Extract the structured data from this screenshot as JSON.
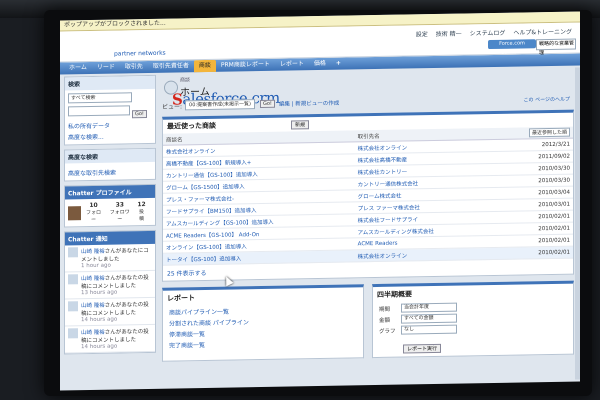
{
  "popup_notice": "ポップアップがブロックされました...",
  "logo": {
    "brand_main": "alesforce",
    "brand_s": "S",
    "brand_crm": " crm",
    "sub": "partner networks"
  },
  "topmeta": [
    "設定",
    "技術 精一",
    "システムログ",
    "ヘルプ&トレーニング"
  ],
  "app_button": "Force.com Sandbox",
  "app_select": "戦略的な営業管理",
  "tabs": [
    {
      "label": "ホーム",
      "active": false
    },
    {
      "label": "リード",
      "active": false
    },
    {
      "label": "取引先",
      "active": false
    },
    {
      "label": "取引先責任者",
      "active": false
    },
    {
      "label": "商談",
      "active": true
    },
    {
      "label": "PRM商談レポート",
      "active": false
    },
    {
      "label": "レポート",
      "active": false
    },
    {
      "label": "価格",
      "active": false
    },
    {
      "label": "+",
      "active": false
    }
  ],
  "sidebar": {
    "search_head": "検索",
    "search_scope": "すべて検索",
    "my_items": "私の所有データ",
    "advanced_link": "高度な検索...",
    "adv_head": "高度な検索",
    "adv_link": "高度な取引先検索",
    "chatter_profile_head": "Chatter プロファイル",
    "stats": [
      {
        "n": "10",
        "l": "フォロー"
      },
      {
        "n": "33",
        "l": "フォロワー"
      },
      {
        "n": "12",
        "l": "投稿"
      }
    ],
    "chatter_notify_head": "Chatter 通知",
    "notifications": [
      {
        "who": "山崎 隆裕",
        "text": "さんがあなたにコメントしました",
        "time": "1 hour ago"
      },
      {
        "who": "山崎 隆裕",
        "text": "さんがあなたの投稿にコメントしました",
        "time": "13 hours ago"
      },
      {
        "who": "山崎 隆裕",
        "text": "さんがあなたの投稿にコメントしました",
        "time": "14 hours ago"
      },
      {
        "who": "山崎 隆裕",
        "text": "さんがあなたの投稿にコメントしました",
        "time": "14 hours ago"
      }
    ]
  },
  "main": {
    "crumb": "商談",
    "title": "ホーム",
    "view_label": "ビュー:",
    "view_select": "00:提案書作成(未掲示一覧)",
    "go": "Go!",
    "view_links": "編集 | 新規ビューの作成",
    "help": "この ページのヘルプ",
    "recent_title": "最近使った商談",
    "new_button": "新規",
    "col_name": "商談名",
    "col_account": "取引先名",
    "col_sort": "最近参照した順",
    "rows": [
      {
        "name": "株式会社オンライン",
        "account": "株式会社オンライン",
        "date": "2012/3/21"
      },
      {
        "name": "高橋不動産【GS-100】新規導入+",
        "account": "株式会社高橋不動産",
        "date": "2011/09/02"
      },
      {
        "name": "カントリー通信【GS-100】追加導入",
        "account": "株式会社カントリー",
        "date": "2010/03/30"
      },
      {
        "name": "グローム【GS-1500】追加導入",
        "account": "カントリー通信株式会社",
        "date": "2010/03/30"
      },
      {
        "name": "プレス・ファーマ株式会社-",
        "account": "グローム株式会社",
        "date": "2010/03/04"
      },
      {
        "name": "フードサプライ【BM150】追加導入",
        "account": "プレス ファーマ株式会社",
        "date": "2010/03/01"
      },
      {
        "name": "アムスカールディング【GS-100】追加導入",
        "account": "株式会社フードサプライ",
        "date": "2010/02/01"
      },
      {
        "name": "ACME Readers【GS-100】 Add-On",
        "account": "アムスカールディング株式会社",
        "date": "2010/02/01"
      },
      {
        "name": "オンライン【GS-100】追加導入",
        "account": "ACME Readers",
        "date": "2010/02/01"
      },
      {
        "name": "トータイ【GS-100】追加導入",
        "account": "株式会社オンライン",
        "date": "2010/02/01"
      }
    ],
    "more_link": "25 件表示する",
    "reports_title": "レポート",
    "reports": [
      "商談パイプライン一覧",
      "分割された商談 パイプライン",
      "停滞商談一覧",
      "完了商談一覧"
    ],
    "quarter_title": "四半期概要",
    "quarter_rows": [
      {
        "label": "期間",
        "value": "当会計年度"
      },
      {
        "label": "金額",
        "value": "すべての金額"
      },
      {
        "label": "グラフ",
        "value": "なし"
      }
    ],
    "run_report": "レポート実行"
  }
}
